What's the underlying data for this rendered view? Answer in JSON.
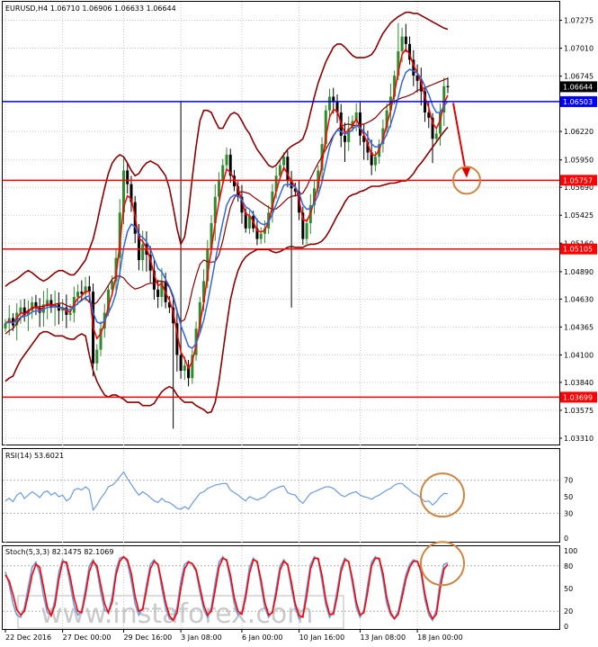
{
  "colors": {
    "frame": "#000000",
    "grid": "#c8c8c8",
    "bull": "#2e8b2e",
    "bear": "#000000",
    "bb": "#8b0000",
    "ema_fast": "#ff0000",
    "ema_slow": "#3366dd",
    "support": "#ff0000",
    "resistance_blue": "#0000ff",
    "annotation": "#cd853f",
    "arrow": "#e00000",
    "rsi": "#6b9be0",
    "stoch_k": "#6b9be0",
    "stoch_d": "#ff0000"
  },
  "chart_data": [
    {
      "type": "candlestick",
      "title": "EURUSD,H4  1.06710 1.06906 1.06633 1.06644",
      "ylim": [
        1.0325,
        1.0745
      ],
      "yticks": [
        1.07275,
        1.0701,
        1.06745,
        1.0622,
        1.0595,
        1.0569,
        1.05425,
        1.0516,
        1.0489,
        1.0463,
        1.04365,
        1.041,
        1.0384,
        1.03575,
        1.0331
      ],
      "ytick_labels": [
        "1.07275",
        "1.07010",
        "1.06745",
        "1.06220",
        "1.05950",
        "1.05690",
        "1.05425",
        "1.05160",
        "1.04890",
        "1.04630",
        "1.04365",
        "1.04100",
        "1.03840",
        "1.03575",
        "1.03310"
      ],
      "xticks": [
        {
          "label": "22 Dec 2016",
          "bar": 0
        },
        {
          "label": "27 Dec 00:00",
          "bar": 15
        },
        {
          "label": "29 Dec 16:00",
          "bar": 31
        },
        {
          "label": "3 Jan 08:00",
          "bar": 46
        },
        {
          "label": "6 Jan 00:00",
          "bar": 62
        },
        {
          "label": "10 Jan 16:00",
          "bar": 77
        },
        {
          "label": "13 Jan 08:00",
          "bar": 93
        },
        {
          "label": "18 Jan 00:00",
          "bar": 108
        }
      ],
      "horizontal_levels": [
        {
          "value": 1.06503,
          "label": "1.06503",
          "color": "#0000ff"
        },
        {
          "value": 1.05757,
          "label": "1.05757",
          "color": "#ff0000"
        },
        {
          "value": 1.05105,
          "label": "1.05105",
          "color": "#ff0000"
        },
        {
          "value": 1.03699,
          "label": "1.03699",
          "color": "#ff0000"
        }
      ],
      "current_price": {
        "value": 1.06644,
        "label": "1.06644"
      },
      "closes": [
        1.044,
        1.0445,
        1.0438,
        1.045,
        1.0455,
        1.0448,
        1.0452,
        1.046,
        1.0455,
        1.045,
        1.0458,
        1.0462,
        1.0455,
        1.0458,
        1.0452,
        1.0455,
        1.0448,
        1.045,
        1.0465,
        1.047,
        1.0468,
        1.0475,
        1.047,
        1.0402,
        1.0415,
        1.0435,
        1.045,
        1.0472,
        1.048,
        1.0502,
        1.0545,
        1.0585,
        1.0572,
        1.0555,
        1.0525,
        1.05,
        1.0515,
        1.0505,
        1.049,
        1.0472,
        1.0465,
        1.048,
        1.046,
        1.0455,
        1.044,
        1.041,
        1.0395,
        1.04,
        1.0388,
        1.041,
        1.0435,
        1.046,
        1.048,
        1.051,
        1.0535,
        1.056,
        1.0575,
        1.059,
        1.06,
        1.058,
        1.057,
        1.056,
        1.0545,
        1.053,
        1.0542,
        1.053,
        1.052,
        1.0525,
        1.053,
        1.0545,
        1.0565,
        1.058,
        1.059,
        1.0598,
        1.0575,
        1.0568,
        1.0565,
        1.0545,
        1.052,
        1.0535,
        1.0552,
        1.0568,
        1.0585,
        1.061,
        1.0642,
        1.0655,
        1.065,
        1.064,
        1.0618,
        1.0612,
        1.0625,
        1.0632,
        1.064,
        1.0618,
        1.0612,
        1.0602,
        1.059,
        1.0598,
        1.061,
        1.0625,
        1.0642,
        1.0655,
        1.0675,
        1.0698,
        1.0712,
        1.0705,
        1.069,
        1.0675,
        1.067,
        1.066,
        1.064,
        1.0635,
        1.0615,
        1.062,
        1.064,
        1.0665,
        1.0664
      ],
      "bb_upper": [
        1.0475,
        1.0478,
        1.048,
        1.0482,
        1.0485,
        1.0488,
        1.049,
        1.0488,
        1.0485,
        1.0482,
        1.048,
        1.0482,
        1.0485,
        1.0488,
        1.049,
        1.049,
        1.0488,
        1.0486,
        1.0486,
        1.049,
        1.0495,
        1.05,
        1.051,
        1.052,
        1.0535,
        1.0552,
        1.0568,
        1.0582,
        1.0592,
        1.0597,
        1.06,
        1.0598,
        1.0592,
        1.0585,
        1.058,
        1.0582,
        1.0588,
        1.0592,
        1.0594,
        1.0592,
        1.059,
        1.0585,
        1.058,
        1.0568,
        1.055,
        1.053,
        1.0515,
        1.0522,
        1.0545,
        1.0578,
        1.0608,
        1.0632,
        1.0642,
        1.0642,
        1.064,
        1.0632,
        1.0625,
        1.0625,
        1.0632,
        1.0638,
        1.064,
        1.0638,
        1.0632,
        1.0625,
        1.062,
        1.0612,
        1.0605,
        1.06,
        1.0595,
        1.059,
        1.0588,
        1.059,
        1.0595,
        1.06,
        1.0605,
        1.0608,
        1.061,
        1.0612,
        1.0615,
        1.0625,
        1.064,
        1.0655,
        1.0668,
        1.0678,
        1.0688,
        1.0695,
        1.0702,
        1.0705,
        1.0705,
        1.0702,
        1.0698,
        1.0694,
        1.0692,
        1.0692,
        1.0692,
        1.0693,
        1.0695,
        1.07,
        1.0708,
        1.0715,
        1.072,
        1.0725,
        1.0728,
        1.0731,
        1.0733,
        1.0735,
        1.0735,
        1.0734,
        1.0734,
        1.0732,
        1.073,
        1.0728,
        1.0726,
        1.0724,
        1.0722,
        1.072,
        1.0719
      ],
      "bb_lower": [
        1.0385,
        1.0388,
        1.039,
        1.0398,
        1.0405,
        1.041,
        1.0415,
        1.042,
        1.0425,
        1.043,
        1.0432,
        1.0432,
        1.043,
        1.0428,
        1.0428,
        1.0428,
        1.0426,
        1.0425,
        1.0425,
        1.0428,
        1.043,
        1.0428,
        1.041,
        1.0395,
        1.0385,
        1.0378,
        1.0372,
        1.037,
        1.0372,
        1.0372,
        1.037,
        1.0368,
        1.0365,
        1.0365,
        1.0365,
        1.0365,
        1.0362,
        1.0362,
        1.0362,
        1.0364,
        1.037,
        1.0375,
        1.0378,
        1.038,
        1.0378,
        1.0372,
        1.0368,
        1.0365,
        1.0365,
        1.0365,
        1.0362,
        1.036,
        1.0358,
        1.0355,
        1.0356,
        1.0365,
        1.0385,
        1.0412,
        1.0438,
        1.0462,
        1.0478,
        1.049,
        1.0498,
        1.0503,
        1.0506,
        1.0508,
        1.051,
        1.051,
        1.051,
        1.051,
        1.0508,
        1.0507,
        1.0508,
        1.051,
        1.0512,
        1.0513,
        1.0512,
        1.0512,
        1.0512,
        1.0514,
        1.0515,
        1.0515,
        1.0516,
        1.0518,
        1.0522,
        1.0528,
        1.0535,
        1.0542,
        1.0548,
        1.0555,
        1.056,
        1.0562,
        1.0563,
        1.0565,
        1.0566,
        1.0568,
        1.057,
        1.057,
        1.057,
        1.0571,
        1.0572,
        1.0573,
        1.0573,
        1.0574,
        1.0575,
        1.0575,
        1.0578,
        1.0582,
        1.0588,
        1.0592,
        1.0597,
        1.0602,
        1.0607,
        1.0612,
        1.0617,
        1.0622,
        1.0626
      ],
      "rsi": {
        "label": "RSI(14) 53.6021",
        "ylim": [
          0,
          100
        ],
        "yticks": [
          0,
          30,
          50,
          70
        ],
        "levels": [
          30,
          70
        ],
        "values": [
          45,
          48,
          44,
          52,
          55,
          48,
          52,
          56,
          53,
          49,
          55,
          57,
          52,
          55,
          50,
          52,
          45,
          48,
          58,
          60,
          58,
          62,
          58,
          34,
          40,
          48,
          54,
          62,
          64,
          68,
          74,
          80,
          72,
          65,
          58,
          52,
          56,
          53,
          49,
          45,
          43,
          48,
          44,
          43,
          40,
          36,
          35,
          38,
          35,
          42,
          48,
          54,
          56,
          60,
          62,
          64,
          65,
          66,
          66,
          58,
          55,
          52,
          48,
          45,
          50,
          48,
          46,
          48,
          50,
          55,
          58,
          60,
          62,
          63,
          55,
          53,
          52,
          46,
          42,
          48,
          54,
          56,
          58,
          60,
          62,
          62,
          60,
          56,
          52,
          50,
          53,
          55,
          56,
          52,
          50,
          49,
          47,
          50,
          52,
          55,
          58,
          60,
          64,
          66,
          66,
          62,
          58,
          54,
          52,
          48,
          44,
          45,
          40,
          44,
          50,
          54,
          53.6
        ]
      },
      "stoch": {
        "label": "Stoch(5,3,3) 82.1475 82.1069",
        "ylim": [
          0,
          100
        ],
        "yticks": [
          0,
          20,
          50,
          80,
          100
        ],
        "levels": [
          20,
          80
        ],
        "k": [
          72,
          55,
          30,
          15,
          12,
          25,
          52,
          78,
          85,
          70,
          40,
          18,
          15,
          35,
          72,
          88,
          82,
          55,
          28,
          15,
          20,
          50,
          80,
          88,
          75,
          45,
          22,
          18,
          40,
          75,
          90,
          92,
          85,
          60,
          30,
          15,
          25,
          55,
          82,
          88,
          80,
          50,
          25,
          10,
          8,
          25,
          60,
          82,
          86,
          82,
          72,
          45,
          22,
          12,
          25,
          58,
          85,
          92,
          86,
          60,
          30,
          15,
          18,
          45,
          78,
          90,
          84,
          55,
          25,
          12,
          20,
          50,
          80,
          88,
          80,
          50,
          25,
          10,
          15,
          50,
          82,
          92,
          88,
          60,
          28,
          12,
          20,
          48,
          78,
          90,
          85,
          55,
          25,
          12,
          22,
          55,
          85,
          92,
          88,
          62,
          30,
          15,
          10,
          20,
          45,
          68,
          82,
          88,
          86,
          70,
          35,
          15,
          8,
          22,
          60,
          82,
          84
        ],
        "d": [
          68,
          60,
          42,
          22,
          15,
          20,
          42,
          68,
          82,
          78,
          52,
          25,
          14,
          28,
          62,
          85,
          85,
          65,
          38,
          20,
          18,
          42,
          72,
          86,
          80,
          55,
          30,
          18,
          32,
          68,
          86,
          92,
          88,
          70,
          40,
          20,
          22,
          48,
          76,
          86,
          82,
          58,
          32,
          14,
          8,
          18,
          50,
          76,
          85,
          83,
          75,
          52,
          28,
          15,
          20,
          48,
          78,
          90,
          88,
          68,
          38,
          20,
          16,
          38,
          70,
          88,
          86,
          62,
          32,
          15,
          18,
          42,
          74,
          86,
          82,
          58,
          30,
          14,
          12,
          40,
          76,
          90,
          90,
          68,
          35,
          16,
          16,
          40,
          72,
          88,
          86,
          62,
          32,
          15,
          18,
          46,
          80,
          90,
          90,
          70,
          38,
          18,
          10,
          16,
          38,
          62,
          78,
          86,
          86,
          74,
          42,
          20,
          10,
          16,
          50,
          76,
          82
        ]
      }
    }
  ],
  "watermark": "www.instaforex.com"
}
